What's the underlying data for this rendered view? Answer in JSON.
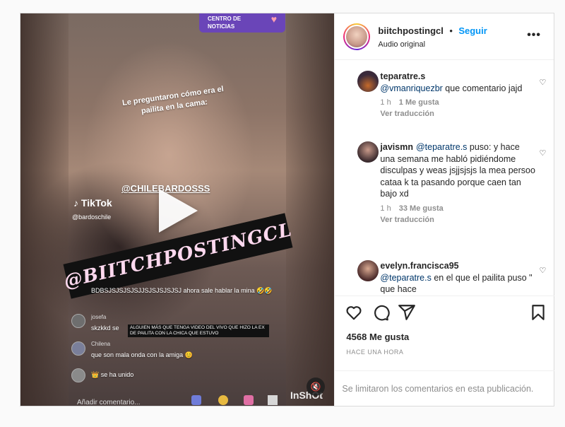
{
  "post": {
    "video": {
      "news_label_line1": "CENTRO DE",
      "news_label_line2": "NOTICIAS",
      "caption": "Le preguntaron cómo era el pailita en la cama:",
      "mention": "@CHILEBARDOSSS",
      "tiktok_brand": "TikTok",
      "tiktok_user": "@bardoschile",
      "banner_text": "@BIITCHPOSTINGCL",
      "chat": [
        {
          "name": "",
          "text": "BDBSJSJSJSJSJJSJSJSJSJSJ ahora sale hablar la mina 🤣🤣"
        },
        {
          "name": "josefa",
          "text": "skzkkd se"
        },
        {
          "name": "Chilena",
          "text": "que son mala onda con la amiga 😊"
        },
        {
          "name": "",
          "text": "se ha unido"
        }
      ],
      "popup_text": "ALGUIEN MÁS QUE TENGA VIDEO DEL VIVO QUE HIZO LA EX DE PAILITA CON LA CHICA QUE ESTUVO",
      "add_comment": "Añadir comentario...",
      "watermark": "InShOt"
    },
    "header": {
      "username": "biitchpostingcl",
      "separator": "•",
      "follow": "Seguir",
      "audio": "Audio original",
      "more": "•••"
    },
    "comments": [
      {
        "user": "teparatre.s",
        "mention": "@vmanriquezbr",
        "text": " que comentario jajd",
        "time": "1 h",
        "likes": "1 Me gusta",
        "translate": "Ver traducción"
      },
      {
        "user": "javismn",
        "mention": "@teparatre.s",
        "text": " puso: y hace una semana me habló pidiéndome disculpas y weas jsjjsjsjs la mea persoo cataa k ta pasando porque caen tan bajo xd",
        "time": "1 h",
        "likes": "33 Me gusta",
        "translate": "Ver traducción"
      },
      {
        "user": "evelyn.francisca95",
        "mention": "@teparatre.s",
        "text": " en el que el pailita puso \" que hace",
        "time": "",
        "likes": "",
        "translate": ""
      }
    ],
    "likes": "4568 Me gusta",
    "time": "HACE UNA HORA",
    "comments_limited": "Se limitaron los comentarios en esta publicación."
  }
}
